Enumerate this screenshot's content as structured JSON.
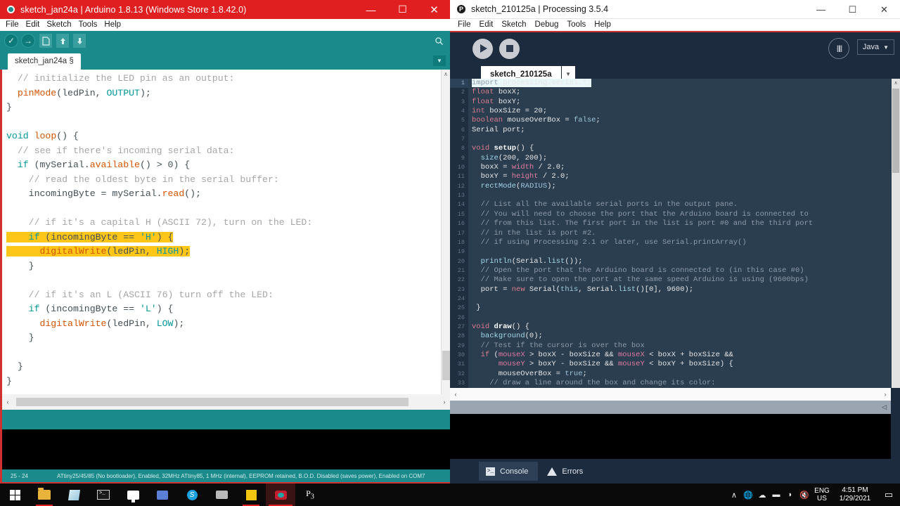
{
  "arduino": {
    "title": "sketch_jan24a | Arduino 1.8.13 (Windows Store 1.8.42.0)",
    "window_buttons": {
      "minimize": "—",
      "maximize": "☐",
      "close": "✕"
    },
    "menu": [
      "File",
      "Edit",
      "Sketch",
      "Tools",
      "Help"
    ],
    "toolbar": {
      "verify": "✓",
      "upload": "→",
      "new_sketch": "new-sketch",
      "open": "open",
      "save": "save",
      "serial_monitor": "⌕"
    },
    "tab": {
      "label": "sketch_jan24a §",
      "dropdown": "▼"
    },
    "code_lines": [
      "  // initialize the LED pin as an output:",
      "  pinMode(ledPin, OUTPUT);",
      "}",
      "",
      "void loop() {",
      "  // see if there's incoming serial data:",
      "  if (mySerial.available() > 0) {",
      "    // read the oldest byte in the serial buffer:",
      "    incomingByte = mySerial.read();",
      "",
      "    // if it's a capital H (ASCII 72), turn on the LED:",
      "    if (incomingByte == 'H') {",
      "      digitalWrite(ledPin, HIGH);",
      "    }",
      "",
      "    // if it's an L (ASCII 76) turn off the LED:",
      "    if (incomingByte == 'L') {",
      "      digitalWrite(ledPin, LOW);",
      "    }",
      "",
      "  }",
      "}"
    ],
    "highlighted_lines": [
      "if (incomingByte == 'H') {",
      "digitalWrite(ledPin, HIGH);"
    ],
    "status": {
      "cursor": "25 - 24",
      "board": "ATtiny25/45/85 (No bootloader), Enabled, 32MHz ATtiny85, 1 MHz (internal), EEPROM retained, B.O.D. Disabled (saves power), Enabled on COM7"
    },
    "scroll": {
      "left_arrow": "‹",
      "right_arrow": "›",
      "up_arrow": "∧",
      "down_arrow": "∨"
    }
  },
  "processing": {
    "title": "sketch_210125a | Processing 3.5.4",
    "logo": "P",
    "window_buttons": {
      "minimize": "—",
      "maximize": "☐",
      "close": "✕"
    },
    "menu": [
      "File",
      "Edit",
      "Sketch",
      "Debug",
      "Tools",
      "Help"
    ],
    "toolbar": {
      "run": "run-icon",
      "stop": "stop-icon",
      "debug": "‖‖",
      "mode": "Java",
      "mode_caret": "▼"
    },
    "tab": {
      "label": "sketch_210125a",
      "menu": "▼"
    },
    "line_numbers": [
      1,
      2,
      3,
      4,
      5,
      6,
      7,
      8,
      9,
      10,
      11,
      12,
      13,
      14,
      15,
      16,
      17,
      18,
      19,
      20,
      21,
      22,
      23,
      24,
      25,
      26,
      27,
      28,
      29,
      30,
      31,
      32,
      33
    ],
    "code_lines": [
      "import processing.serial.*;",
      "float boxX;",
      "float boxY;",
      "int boxSize = 20;",
      "boolean mouseOverBox = false;",
      "Serial port;",
      "",
      "void setup() {",
      "  size(200, 200);",
      "  boxX = width / 2.0;",
      "  boxY = height / 2.0;",
      "  rectMode(RADIUS);",
      "",
      "  // List all the available serial ports in the output pane.",
      "  // You will need to choose the port that the Arduino board is connected to",
      "  // from this list. The first port in the list is port #0 and the third port",
      "  // in the list is port #2.",
      "  // if using Processing 2.1 or later, use Serial.printArray()",
      "",
      "  println(Serial.list());",
      "  // Open the port that the Arduino board is connected to (in this case #0)",
      "  // Make sure to open the port at the same speed Arduino is using (9600bps)",
      "  port = new Serial(this, Serial.list()[0], 9600);",
      "",
      "}",
      "",
      "void draw() {",
      "  background(0);",
      "  // Test if the cursor is over the box",
      "  if (mouseX > boxX - boxSize && mouseX < boxX + boxSize &&",
      "      mouseY > boxY - boxSize && mouseY < boxY + boxSize) {",
      "      mouseOverBox = true;",
      "    // draw a line around the box and change its color:"
    ],
    "bottom_tabs": [
      {
        "label": "Console",
        "icon": "console-icon",
        "active": true
      },
      {
        "label": "Errors",
        "icon": "warning-icon",
        "active": false
      }
    ],
    "scroll": {
      "left_arrow": "‹",
      "right_arrow": "›",
      "up_arrow": "∧",
      "down_arrow": "∨",
      "resize": "◁"
    }
  },
  "taskbar": {
    "items": [
      {
        "name": "start-button",
        "icon": "windows-logo-icon"
      },
      {
        "name": "file-explorer",
        "icon": "folder-icon"
      },
      {
        "name": "microsoft-store",
        "icon": "store-icon"
      },
      {
        "name": "terminal",
        "icon": "terminal-icon"
      },
      {
        "name": "remote-desktop",
        "icon": "monitor-icon"
      },
      {
        "name": "teams",
        "icon": "teams-icon"
      },
      {
        "name": "skype",
        "icon": "skype-icon"
      },
      {
        "name": "snipping-tool",
        "icon": "snip-icon"
      },
      {
        "name": "sticky-notes",
        "icon": "note-icon"
      },
      {
        "name": "arduino-ide",
        "icon": "arduino-icon"
      },
      {
        "name": "processing-ide",
        "icon": "processing-icon"
      }
    ],
    "tray": {
      "show_hidden": "∧",
      "icons": [
        "globe-icon",
        "onedrive-icon",
        "battery-icon",
        "wifi-icon",
        "volume-muted-icon"
      ],
      "language_line1": "ENG",
      "language_line2": "US",
      "time": "4:51 PM",
      "date": "1/29/2021",
      "notifications": "▭"
    }
  }
}
